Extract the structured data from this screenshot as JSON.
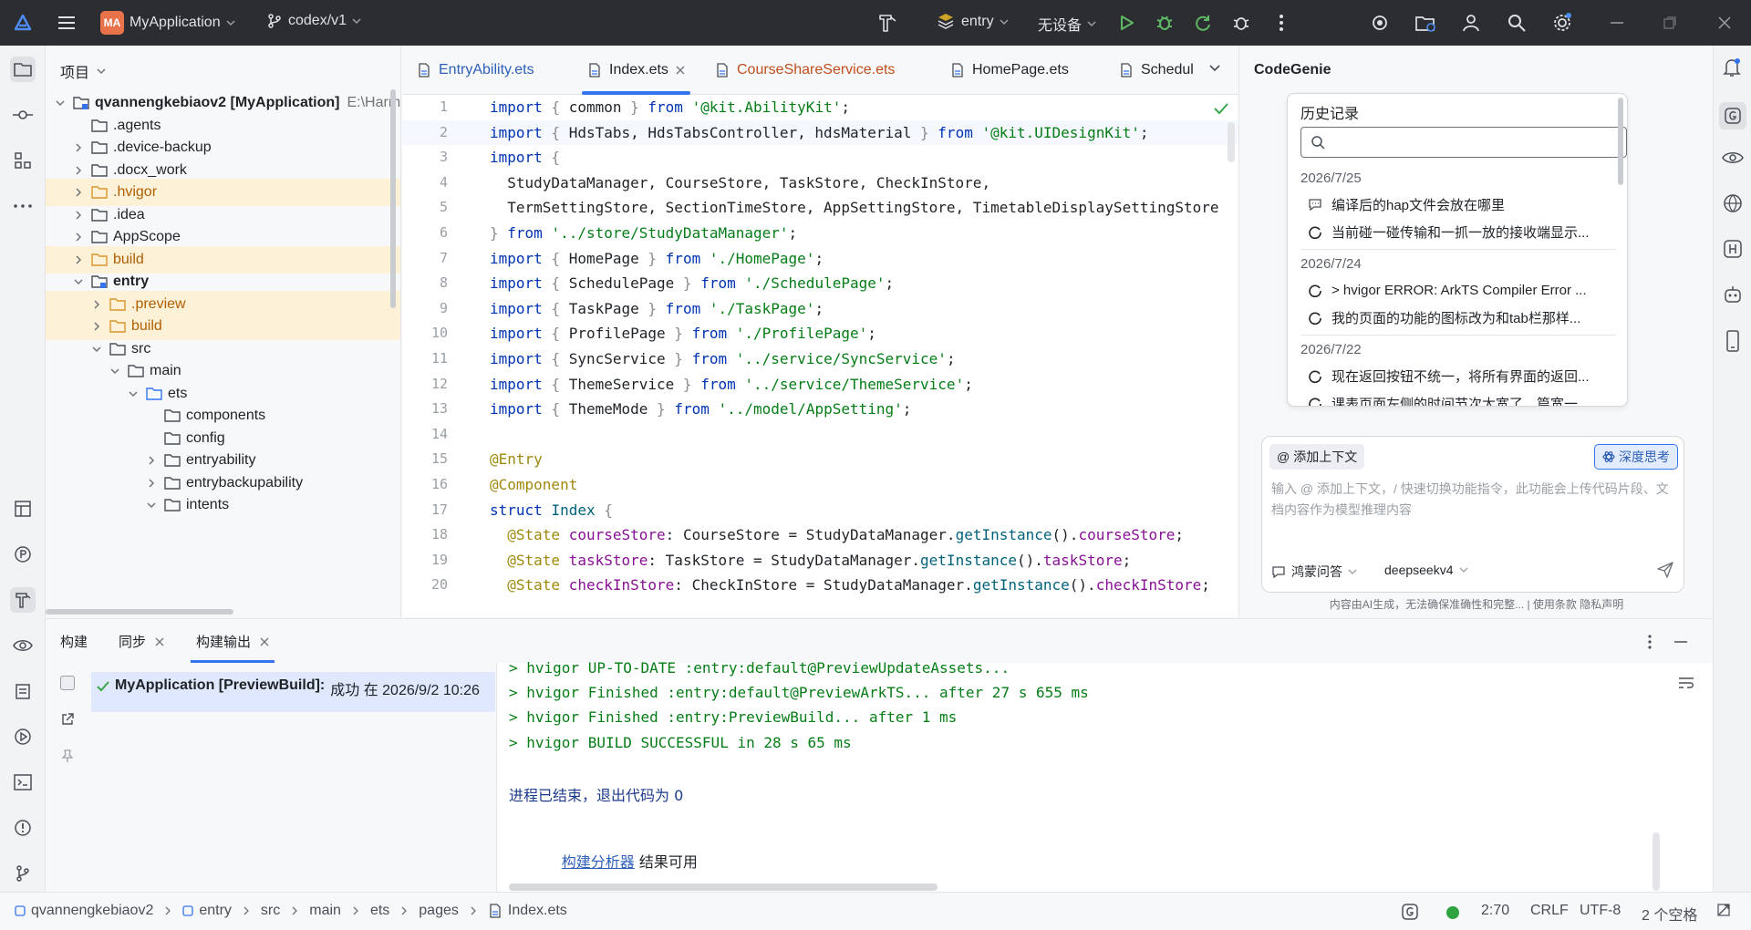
{
  "titlebar": {
    "project_badge": "MA",
    "project_name": "MyApplication",
    "branch": "codex/v1",
    "module": "entry",
    "device": "无设备"
  },
  "project_panel": {
    "header": "项目",
    "tree": [
      {
        "name": "qvannengkebiaov2 [MyApplication]",
        "path": "E:\\Harm",
        "depth": 0,
        "expanded": true,
        "kind": "module",
        "bold": true,
        "hl": false
      },
      {
        "name": ".agents",
        "depth": 1,
        "expanded": null,
        "kind": "folder",
        "hl": false
      },
      {
        "name": ".device-backup",
        "depth": 1,
        "expanded": false,
        "kind": "folder",
        "hl": false
      },
      {
        "name": ".docx_work",
        "depth": 1,
        "expanded": false,
        "kind": "folder",
        "hl": false
      },
      {
        "name": ".hvigor",
        "depth": 1,
        "expanded": false,
        "kind": "folder-orange",
        "hl": true
      },
      {
        "name": ".idea",
        "depth": 1,
        "expanded": false,
        "kind": "folder",
        "hl": false
      },
      {
        "name": "AppScope",
        "depth": 1,
        "expanded": false,
        "kind": "folder",
        "hl": false
      },
      {
        "name": "build",
        "depth": 1,
        "expanded": false,
        "kind": "folder-orange",
        "hl": true
      },
      {
        "name": "entry",
        "depth": 1,
        "expanded": true,
        "kind": "module",
        "bold": true,
        "hl": false
      },
      {
        "name": ".preview",
        "depth": 2,
        "expanded": false,
        "kind": "folder-orange",
        "hl": true
      },
      {
        "name": "build",
        "depth": 2,
        "expanded": false,
        "kind": "folder-orange",
        "hl": true
      },
      {
        "name": "src",
        "depth": 2,
        "expanded": true,
        "kind": "folder",
        "hl": false
      },
      {
        "name": "main",
        "depth": 3,
        "expanded": true,
        "kind": "folder",
        "hl": false
      },
      {
        "name": "ets",
        "depth": 4,
        "expanded": true,
        "kind": "folder-blue",
        "hl": false
      },
      {
        "name": "components",
        "depth": 5,
        "expanded": null,
        "kind": "folder",
        "hl": false
      },
      {
        "name": "config",
        "depth": 5,
        "expanded": null,
        "kind": "folder",
        "hl": false
      },
      {
        "name": "entryability",
        "depth": 5,
        "expanded": false,
        "kind": "folder",
        "hl": false
      },
      {
        "name": "entrybackupability",
        "depth": 5,
        "expanded": false,
        "kind": "folder",
        "hl": false
      },
      {
        "name": "intents",
        "depth": 5,
        "expanded": true,
        "kind": "folder",
        "hl": false
      }
    ]
  },
  "editor": {
    "tabs": [
      {
        "name": "EntryAbility.ets",
        "style": "blue",
        "active": false,
        "closable": false
      },
      {
        "name": "Index.ets",
        "style": "normal",
        "active": true,
        "closable": true
      },
      {
        "name": "CourseShareService.ets",
        "style": "modified",
        "active": false,
        "closable": false
      },
      {
        "name": "HomePage.ets",
        "style": "normal",
        "active": false,
        "closable": false
      },
      {
        "name": "Schedul",
        "style": "normal",
        "active": false,
        "closable": false
      }
    ],
    "lines": [
      {
        "n": "1",
        "tokens": [
          [
            "k",
            "import"
          ],
          [
            "g",
            " { "
          ],
          [
            "",
            "common"
          ],
          [
            "g",
            " } "
          ],
          [
            "k",
            "from"
          ],
          [
            "",
            " "
          ],
          [
            "s",
            "'@kit.AbilityKit'"
          ],
          [
            "",
            ";"
          ]
        ]
      },
      {
        "n": "2",
        "tokens": [
          [
            "k",
            "import"
          ],
          [
            "g",
            " { "
          ],
          [
            "",
            "HdsTabs, HdsTabsController, hdsMaterial"
          ],
          [
            "g",
            " } "
          ],
          [
            "k",
            "from"
          ],
          [
            "",
            " "
          ],
          [
            "s",
            "'@kit.UIDesignKit'"
          ],
          [
            "",
            ";"
          ]
        ]
      },
      {
        "n": "3",
        "tokens": [
          [
            "k",
            "import"
          ],
          [
            "g",
            " {"
          ]
        ]
      },
      {
        "n": "4",
        "tokens": [
          [
            "",
            "  StudyDataManager, CourseStore, TaskStore, CheckInStore,"
          ]
        ]
      },
      {
        "n": "5",
        "tokens": [
          [
            "",
            "  TermSettingStore, SectionTimeStore, AppSettingStore, TimetableDisplaySettingStore"
          ]
        ]
      },
      {
        "n": "6",
        "tokens": [
          [
            "g",
            "} "
          ],
          [
            "k",
            "from"
          ],
          [
            "",
            " "
          ],
          [
            "s",
            "'../store/StudyDataManager'"
          ],
          [
            "",
            ";"
          ]
        ]
      },
      {
        "n": "7",
        "tokens": [
          [
            "k",
            "import"
          ],
          [
            "g",
            " { "
          ],
          [
            "",
            "HomePage"
          ],
          [
            "g",
            " } "
          ],
          [
            "k",
            "from"
          ],
          [
            "",
            " "
          ],
          [
            "s",
            "'./HomePage'"
          ],
          [
            "",
            ";"
          ]
        ]
      },
      {
        "n": "8",
        "tokens": [
          [
            "k",
            "import"
          ],
          [
            "g",
            " { "
          ],
          [
            "",
            "SchedulePage"
          ],
          [
            "g",
            " } "
          ],
          [
            "k",
            "from"
          ],
          [
            "",
            " "
          ],
          [
            "s",
            "'./SchedulePage'"
          ],
          [
            "",
            ";"
          ]
        ]
      },
      {
        "n": "9",
        "tokens": [
          [
            "k",
            "import"
          ],
          [
            "g",
            " { "
          ],
          [
            "",
            "TaskPage"
          ],
          [
            "g",
            " } "
          ],
          [
            "k",
            "from"
          ],
          [
            "",
            " "
          ],
          [
            "s",
            "'./TaskPage'"
          ],
          [
            "",
            ";"
          ]
        ]
      },
      {
        "n": "10",
        "tokens": [
          [
            "k",
            "import"
          ],
          [
            "g",
            " { "
          ],
          [
            "",
            "ProfilePage"
          ],
          [
            "g",
            " } "
          ],
          [
            "k",
            "from"
          ],
          [
            "",
            " "
          ],
          [
            "s",
            "'./ProfilePage'"
          ],
          [
            "",
            ";"
          ]
        ]
      },
      {
        "n": "11",
        "tokens": [
          [
            "k",
            "import"
          ],
          [
            "g",
            " { "
          ],
          [
            "",
            "SyncService"
          ],
          [
            "g",
            " } "
          ],
          [
            "k",
            "from"
          ],
          [
            "",
            " "
          ],
          [
            "s",
            "'../service/SyncService'"
          ],
          [
            "",
            ";"
          ]
        ]
      },
      {
        "n": "12",
        "tokens": [
          [
            "k",
            "import"
          ],
          [
            "g",
            " { "
          ],
          [
            "",
            "ThemeService"
          ],
          [
            "g",
            " } "
          ],
          [
            "k",
            "from"
          ],
          [
            "",
            " "
          ],
          [
            "s",
            "'../service/ThemeService'"
          ],
          [
            "",
            ";"
          ]
        ]
      },
      {
        "n": "13",
        "tokens": [
          [
            "k",
            "import"
          ],
          [
            "g",
            " { "
          ],
          [
            "",
            "ThemeMode"
          ],
          [
            "g",
            " } "
          ],
          [
            "k",
            "from"
          ],
          [
            "",
            " "
          ],
          [
            "s",
            "'../model/AppSetting'"
          ],
          [
            "",
            ";"
          ]
        ]
      },
      {
        "n": "14",
        "tokens": []
      },
      {
        "n": "15",
        "tokens": [
          [
            "d",
            "@Entry"
          ]
        ]
      },
      {
        "n": "16",
        "tokens": [
          [
            "d",
            "@Component"
          ]
        ]
      },
      {
        "n": "17",
        "tokens": [
          [
            "k",
            "struct"
          ],
          [
            "",
            " "
          ],
          [
            "f",
            "Index"
          ],
          [
            "g",
            " {"
          ]
        ]
      },
      {
        "n": "18",
        "tokens": [
          [
            "d",
            "  @State"
          ],
          [
            "",
            " "
          ],
          [
            "p",
            "courseStore"
          ],
          [
            "",
            ": CourseStore = StudyDataManager."
          ],
          [
            "f",
            "getInstance"
          ],
          [
            "",
            "()."
          ],
          [
            "p",
            "courseStore"
          ],
          [
            "",
            ";"
          ]
        ]
      },
      {
        "n": "19",
        "tokens": [
          [
            "d",
            "  @State"
          ],
          [
            "",
            " "
          ],
          [
            "p",
            "taskStore"
          ],
          [
            "",
            ": TaskStore = StudyDataManager."
          ],
          [
            "f",
            "getInstance"
          ],
          [
            "",
            "()."
          ],
          [
            "p",
            "taskStore"
          ],
          [
            "",
            ";"
          ]
        ]
      },
      {
        "n": "20",
        "tokens": [
          [
            "d",
            "  @State"
          ],
          [
            "",
            " "
          ],
          [
            "p",
            "checkInStore"
          ],
          [
            "",
            ": CheckInStore = StudyDataManager."
          ],
          [
            "f",
            "getInstance"
          ],
          [
            "",
            "()."
          ],
          [
            "p",
            "checkInStore"
          ],
          [
            "",
            ";"
          ]
        ]
      }
    ]
  },
  "codegenie": {
    "title": "CodeGenie",
    "history_title": "历史记录",
    "groups": [
      {
        "date": "2026/7/25",
        "items": [
          {
            "icon": "chat",
            "text": "编译后的hap文件会放在哪里"
          },
          {
            "icon": "loop",
            "text": "当前碰一碰传输和一抓一放的接收端显示..."
          }
        ]
      },
      {
        "date": "2026/7/24",
        "items": [
          {
            "icon": "loop",
            "text": "> hvigor ERROR: ArkTS Compiler Error ..."
          },
          {
            "icon": "loop",
            "text": "我的页面的功能的图标改为和tab栏那样..."
          }
        ]
      },
      {
        "date": "2026/7/22",
        "items": [
          {
            "icon": "loop",
            "text": "现在返回按钮不统一，将所有界面的返回..."
          },
          {
            "icon": "loop",
            "text": "课表页面左侧的时间节次太宽了，篇宽一..."
          }
        ]
      }
    ],
    "add_context": "添加上下文",
    "deep_think": "深度思考",
    "input_placeholder": "输入 @ 添加上下文，/ 快速切换功能指令，此功能会上传代码片段、文档内容作为模型推理内容",
    "mode": "鸿蒙问答",
    "model": "deepseekv4",
    "footer": "内容由AI生成，无法确保准确性和完整... | 使用条款  隐私声明"
  },
  "bottom_panel": {
    "tabs": [
      {
        "label": "构建",
        "closable": false,
        "active": false
      },
      {
        "label": "同步",
        "closable": true,
        "active": false
      },
      {
        "label": "构建输出",
        "closable": true,
        "active": true
      }
    ],
    "build_title": "MyApplication [PreviewBuild]:",
    "build_status": "成功 在 2026/9/2 10:26",
    "console": [
      {
        "style": "green",
        "text": "> hvigor UP-TO-DATE :entry:default@PreviewUpdateAssets..."
      },
      {
        "style": "green",
        "text": "> hvigor Finished :entry:default@PreviewArkTS... after 27 s 655 ms"
      },
      {
        "style": "green",
        "text": "> hvigor Finished :entry:PreviewBuild... after 1 ms"
      },
      {
        "style": "green",
        "text": "> hvigor BUILD SUCCESSFUL in 28 s 65 ms"
      },
      {
        "style": "navy",
        "text": "进程已结束，退出代码为 0"
      }
    ],
    "analyzer_link": "构建分析器",
    "analyzer_text": " 结果可用"
  },
  "statusbar": {
    "breadcrumb": [
      "qvannengkebiaov2",
      "entry",
      "src",
      "main",
      "ets",
      "pages",
      "Index.ets"
    ],
    "position": "2:70",
    "line_sep": "CRLF",
    "encoding": "UTF-8",
    "indent": "2 个空格"
  }
}
